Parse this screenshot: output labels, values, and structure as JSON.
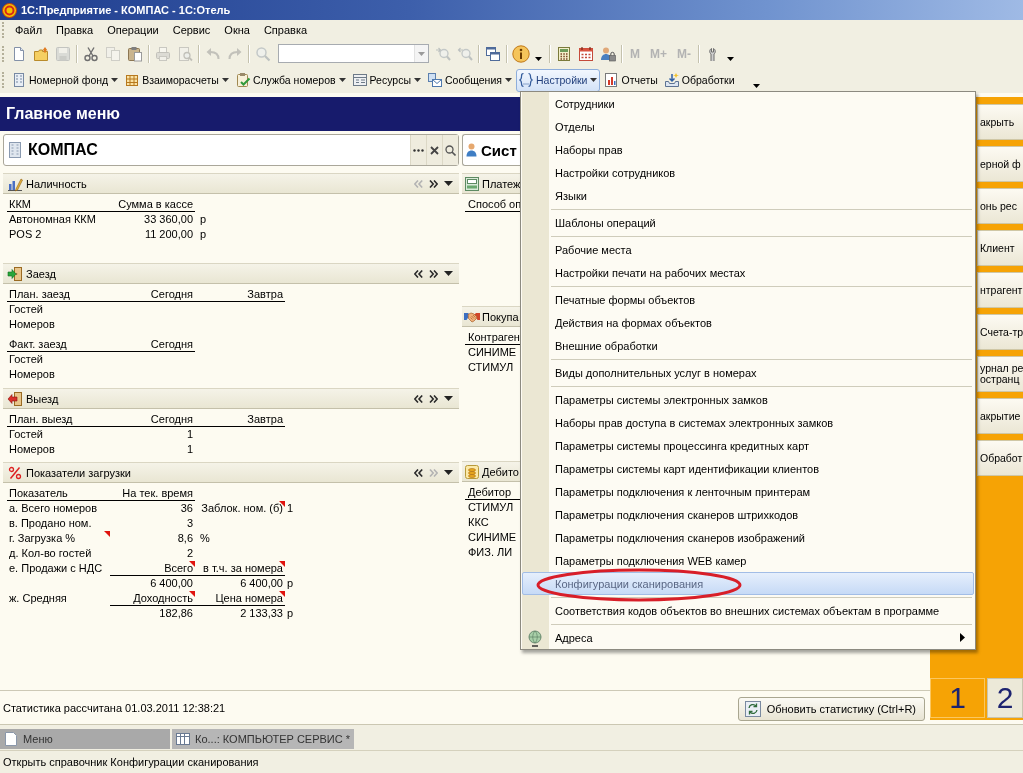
{
  "window": {
    "title": "1С:Предприятие - КОМПАС - 1С:Отель"
  },
  "menu_bar": [
    "Файл",
    "Правка",
    "Операции",
    "Сервис",
    "Окна",
    "Справка"
  ],
  "toolbar": [
    {
      "kind": "icon",
      "disabled": false,
      "dropdown": false
    },
    {
      "kind": "icon",
      "disabled": false,
      "dropdown": false
    },
    {
      "kind": "icon",
      "disabled": true,
      "dropdown": false
    },
    {
      "kind": "separator"
    },
    {
      "kind": "icon",
      "disabled": false,
      "dropdown": false
    },
    {
      "kind": "icon",
      "disabled": true,
      "dropdown": false
    },
    {
      "kind": "icon",
      "disabled": false,
      "dropdown": false
    },
    {
      "kind": "separator"
    },
    {
      "kind": "icon",
      "disabled": true,
      "dropdown": false
    },
    {
      "kind": "icon",
      "disabled": true,
      "dropdown": false
    },
    {
      "kind": "separator"
    },
    {
      "kind": "icon",
      "disabled": true,
      "dropdown": false
    },
    {
      "kind": "icon",
      "disabled": true,
      "dropdown": false
    },
    {
      "kind": "separator"
    },
    {
      "kind": "icon",
      "disabled": true,
      "dropdown": false
    },
    {
      "kind": "search"
    },
    {
      "kind": "icon",
      "disabled": true,
      "dropdown": false
    },
    {
      "kind": "icon",
      "disabled": true,
      "dropdown": false
    },
    {
      "kind": "separator"
    },
    {
      "kind": "icon",
      "disabled": false,
      "dropdown": false
    },
    {
      "kind": "separator"
    },
    {
      "kind": "icon",
      "disabled": false,
      "dropdown": true
    },
    {
      "kind": "separator"
    },
    {
      "kind": "icon",
      "disabled": false,
      "dropdown": false
    },
    {
      "kind": "icon",
      "disabled": false,
      "dropdown": false
    },
    {
      "kind": "icon",
      "disabled": false,
      "dropdown": false
    },
    {
      "kind": "separator"
    },
    {
      "kind": "text",
      "label": "M",
      "disabled": true
    },
    {
      "kind": "text",
      "label": "M+",
      "disabled": true
    },
    {
      "kind": "text",
      "label": "M-",
      "disabled": true
    },
    {
      "kind": "separator"
    },
    {
      "kind": "icon",
      "disabled": false,
      "dropdown": true
    }
  ],
  "command_bar": [
    {
      "label": "Номерной фонд",
      "dropdown": true,
      "pressed": false
    },
    {
      "label": "Взаиморасчеты",
      "dropdown": true,
      "pressed": false
    },
    {
      "label": "Служба номеров",
      "dropdown": true,
      "pressed": false
    },
    {
      "label": "Ресурсы",
      "dropdown": true,
      "pressed": false
    },
    {
      "label": "Сообщения",
      "dropdown": true,
      "pressed": false
    },
    {
      "label": "Настройки",
      "dropdown": true,
      "pressed": true
    },
    {
      "label": "Отчеты",
      "dropdown": false,
      "pressed": false
    },
    {
      "label": "Обработки",
      "dropdown": false,
      "pressed": false
    }
  ],
  "main_menu": {
    "title": "Главное меню",
    "left_panel": {
      "field": {
        "value": "КОМПАС"
      },
      "sections": [
        {
          "title": "Наличность",
          "prev_enabled": false,
          "next_enabled": true,
          "rows": [
            {
              "kind": "header",
              "label": "ККМ",
              "value": "Сумма в кассе"
            },
            {
              "kind": "data",
              "label": "Автономная ККМ",
              "value": "33 360,00",
              "unit": "р"
            },
            {
              "kind": "data",
              "label": "POS 2",
              "value": "11 200,00",
              "unit": "р"
            }
          ]
        },
        {
          "title": "Заезд",
          "prev_enabled": true,
          "next_enabled": true,
          "rows": [
            {
              "kind": "header",
              "label": "План. заезд",
              "value": "Сегодня",
              "detail": "Завтра"
            },
            {
              "kind": "data",
              "label": "Гостей"
            },
            {
              "kind": "data",
              "label": "Номеров"
            },
            {
              "kind": "header",
              "label": "Факт. заезд",
              "value": "Сегодня"
            },
            {
              "kind": "data",
              "label": "Гостей"
            },
            {
              "kind": "data",
              "label": "Номеров"
            }
          ]
        },
        {
          "title": "Выезд",
          "prev_enabled": true,
          "next_enabled": true,
          "rows": [
            {
              "kind": "header",
              "label": "План. выезд",
              "value": "Сегодня",
              "detail": "Завтра"
            },
            {
              "kind": "data",
              "label": "Гостей",
              "value": "1"
            },
            {
              "kind": "data",
              "label": "Номеров",
              "value": "1"
            }
          ]
        },
        {
          "title": "Показатели загрузки",
          "prev_enabled": true,
          "next_enabled": false,
          "rows": [
            {
              "kind": "header",
              "label": "Показатель",
              "value": "На тек. время",
              "label_note": false,
              "value_note": false,
              "detail_note": false
            },
            {
              "kind": "data",
              "label": "а. Всего номеров",
              "value": "36",
              "detail": "Заблок. ном. (б)",
              "extra": "1",
              "label_note": false,
              "value_note": false,
              "detail_note": true
            },
            {
              "kind": "data",
              "label": "в. Продано ном.",
              "value": "3",
              "label_note": false,
              "value_note": false,
              "detail_note": false
            },
            {
              "kind": "data",
              "label": "г. Загрузка %",
              "value": "8,6",
              "unit": "%",
              "label_note": true,
              "value_note": false,
              "detail_note": false
            },
            {
              "kind": "data",
              "label": "д. Кол-во гостей",
              "value": "2",
              "label_note": false,
              "value_note": false,
              "detail_note": false
            },
            {
              "kind": "subheader",
              "label": "е. Продажи с НДС",
              "value": "Всего",
              "detail": "в т.ч. за номера",
              "label_note": false,
              "value_note": true,
              "detail_note": true
            },
            {
              "kind": "data",
              "value": "6 400,00",
              "detail": "6 400,00",
              "extra": "р",
              "label_note": false,
              "value_note": false,
              "detail_note": false
            },
            {
              "kind": "subheader",
              "label": "ж. Средняя",
              "value": "Доходность",
              "detail": "Цена номера",
              "label_note": false,
              "value_note": true,
              "detail_note": true
            },
            {
              "kind": "data",
              "value": "182,86",
              "detail": "2 133,33",
              "extra": "р",
              "label_note": false,
              "value_note": false,
              "detail_note": false
            }
          ]
        }
      ]
    },
    "middle_panel": {
      "field": {
        "value": "Сист"
      },
      "sections": [
        {
          "title": "Платеж",
          "column": "Способ оп"
        },
        {
          "title": "Покупа",
          "column": "Контраген",
          "rows": [
            "СИНИМЕ",
            "СТИМУЛ"
          ]
        },
        {
          "title": "Дебито",
          "column": "Дебитор",
          "rows": [
            "СТИМУЛ",
            "ККС",
            "СИНИМЕ",
            "ФИЗ. ЛИ"
          ]
        }
      ]
    },
    "right_panel": {
      "buttons": [
        {
          "label": "акрыть"
        },
        {
          "label": "ерной ф"
        },
        {
          "label": "онь рес"
        },
        {
          "label": "Клиент"
        },
        {
          "label": "нтрагент"
        },
        {
          "label": "Счета-тр"
        },
        {
          "label": "урнал ре\nостранц"
        },
        {
          "label": "акрытие"
        },
        {
          "label": "Обработ"
        }
      ],
      "desktops": [
        {
          "label": "1",
          "selected": true
        },
        {
          "label": "2",
          "selected": false
        }
      ]
    },
    "footer": {
      "text": "Статистика рассчитана 01.03.2011 12:38:21",
      "button": "Обновить статистику (Ctrl+R)"
    }
  },
  "dropdown_menu": {
    "sections": [
      {
        "items": [
          {
            "label": "Сотрудники",
            "selected": false,
            "circled": false,
            "submenu": false,
            "has_icon": false
          },
          {
            "label": "Отделы",
            "selected": false,
            "circled": false,
            "submenu": false,
            "has_icon": false
          },
          {
            "label": "Наборы прав",
            "selected": false,
            "circled": false,
            "submenu": false,
            "has_icon": false
          },
          {
            "label": "Настройки сотрудников",
            "selected": false,
            "circled": false,
            "submenu": false,
            "has_icon": false
          },
          {
            "label": "Языки",
            "selected": false,
            "circled": false,
            "submenu": false,
            "has_icon": false
          }
        ]
      },
      {
        "items": [
          {
            "label": "Шаблоны операций",
            "selected": false,
            "circled": false,
            "submenu": false,
            "has_icon": false
          }
        ]
      },
      {
        "items": [
          {
            "label": "Рабочие места",
            "selected": false,
            "circled": false,
            "submenu": false,
            "has_icon": false
          },
          {
            "label": "Настройки печати на рабочих местах",
            "selected": false,
            "circled": false,
            "submenu": false,
            "has_icon": false
          }
        ]
      },
      {
        "items": [
          {
            "label": "Печатные формы объектов",
            "selected": false,
            "circled": false,
            "submenu": false,
            "has_icon": false
          },
          {
            "label": "Действия на формах объектов",
            "selected": false,
            "circled": false,
            "submenu": false,
            "has_icon": false
          },
          {
            "label": "Внешние обработки",
            "selected": false,
            "circled": false,
            "submenu": false,
            "has_icon": false
          }
        ]
      },
      {
        "items": [
          {
            "label": "Виды дополнительных услуг в номерах",
            "selected": false,
            "circled": false,
            "submenu": false,
            "has_icon": false
          }
        ]
      },
      {
        "items": [
          {
            "label": "Параметры системы электронных замков",
            "selected": false,
            "circled": false,
            "submenu": false,
            "has_icon": false
          },
          {
            "label": "Наборы прав доступа в системах электронных замков",
            "selected": false,
            "circled": false,
            "submenu": false,
            "has_icon": false
          },
          {
            "label": "Параметры системы процессинга кредитных карт",
            "selected": false,
            "circled": false,
            "submenu": false,
            "has_icon": false
          },
          {
            "label": "Параметры системы карт идентификации клиентов",
            "selected": false,
            "circled": false,
            "submenu": false,
            "has_icon": false
          },
          {
            "label": "Параметры подключения к ленточным принтерам",
            "selected": false,
            "circled": false,
            "submenu": false,
            "has_icon": false
          },
          {
            "label": "Параметры подключения сканеров штрихкодов",
            "selected": false,
            "circled": false,
            "submenu": false,
            "has_icon": false
          },
          {
            "label": "Параметры подключения сканеров изображений",
            "selected": false,
            "circled": false,
            "submenu": false,
            "has_icon": false
          },
          {
            "label": "Параметры подключения WEB камер",
            "selected": false,
            "circled": false,
            "submenu": false,
            "has_icon": false
          },
          {
            "label": "Конфигурации сканирования",
            "selected": true,
            "circled": true,
            "submenu": false,
            "has_icon": false
          }
        ]
      },
      {
        "items": [
          {
            "label": "Соответствия кодов объектов во внешних системах объектам в программе",
            "selected": false,
            "circled": false,
            "submenu": false,
            "has_icon": false
          }
        ]
      },
      {
        "items": [
          {
            "label": "Адреса",
            "selected": false,
            "circled": false,
            "submenu": true,
            "has_icon": true
          }
        ]
      }
    ]
  },
  "taskbar": [
    {
      "label": "Меню",
      "selected": true
    },
    {
      "label": "Ко...: КОМПЬЮТЕР СЕРВИС *",
      "selected": false
    }
  ],
  "status_bar": "Открыть справочник Конфигурации сканирования"
}
